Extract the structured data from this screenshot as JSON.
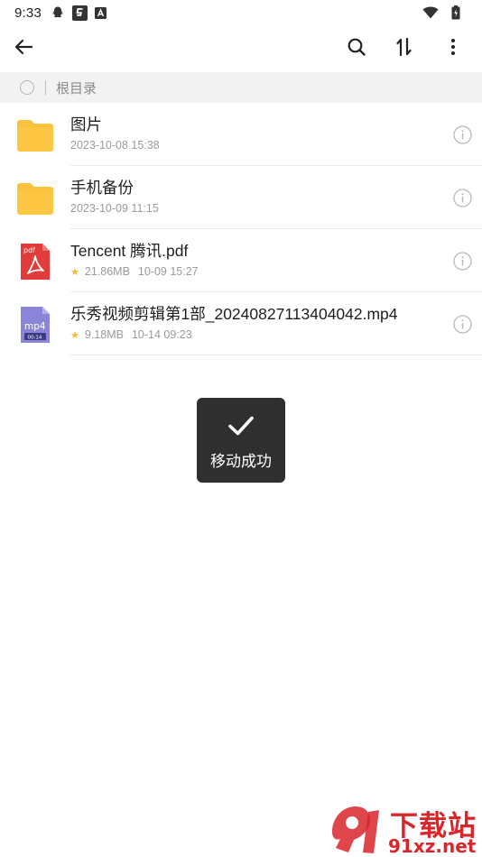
{
  "status_bar": {
    "time": "9:33",
    "left_icons": [
      "qq-icon",
      "sohu-icon",
      "a-icon"
    ],
    "right_icons": [
      "wifi-icon",
      "battery-icon"
    ]
  },
  "toolbar": {
    "back_icon": "back-arrow-icon",
    "search_icon": "search-icon",
    "sort_icon": "sort-icon",
    "more_icon": "more-vertical-icon"
  },
  "path_bar": {
    "crumb": "根目录"
  },
  "files": [
    {
      "name": "图片",
      "type": "folder",
      "starred": false,
      "size": "",
      "date": "2023-10-08 15:38"
    },
    {
      "name": "手机备份",
      "type": "folder",
      "starred": false,
      "size": "",
      "date": "2023-10-09 11:15"
    },
    {
      "name": "Tencent 腾讯.pdf",
      "type": "pdf",
      "icon_label": "pdf",
      "starred": true,
      "size": "21.86MB",
      "date": "10-09 15:27"
    },
    {
      "name": "乐秀视频剪辑第1部_20240827113404042.mp4",
      "type": "mp4",
      "icon_label": "mp4",
      "icon_duration": "00:14",
      "starred": true,
      "size": "9.18MB",
      "date": "10-14 09:23"
    }
  ],
  "toast": {
    "message": "移动成功",
    "icon": "check-icon"
  },
  "watermark": {
    "title": "下载站",
    "domain": "91xz.net"
  },
  "colors": {
    "folder": "#fbc33d",
    "pdf": "#e23b3b",
    "mp4": "#8a85d8",
    "star": "#f7b731",
    "toast_bg": "#2f2f2f",
    "watermark": "#d9262b"
  }
}
